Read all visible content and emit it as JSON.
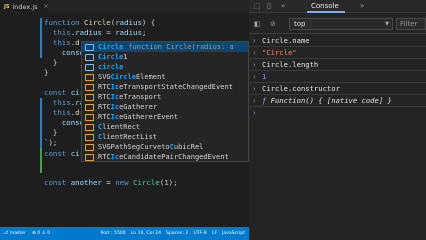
{
  "editor": {
    "tab": {
      "filename": "index.js",
      "badge": "JS",
      "close": "×"
    },
    "lines": [
      [
        [
          "kw",
          "function "
        ],
        [
          "fn",
          "Circle"
        ],
        [
          "pn",
          "("
        ],
        [
          "var",
          "radius"
        ],
        [
          "pn",
          ") {"
        ]
      ],
      [
        [
          "pn",
          "  "
        ],
        [
          "kw",
          "this"
        ],
        [
          "pn",
          "."
        ],
        [
          "var",
          "radius"
        ],
        [
          "pn",
          " = "
        ],
        [
          "var",
          "radius"
        ],
        [
          "pn",
          ";"
        ]
      ],
      [
        [
          "pn",
          "  "
        ],
        [
          "kw",
          "this"
        ],
        [
          "pn",
          "."
        ],
        [
          "fn",
          "d"
        ]
      ],
      [
        [
          "pn",
          "    "
        ],
        [
          "var",
          "conso"
        ]
      ],
      [
        [
          "pn",
          "  }"
        ]
      ],
      [
        [
          "pn",
          "}"
        ]
      ],
      [
        [
          "pn",
          ""
        ]
      ],
      [
        [
          "kw",
          "const "
        ],
        [
          "var",
          "circle"
        ],
        [
          "pn",
          " = {"
        ]
      ],
      [
        [
          "pn",
          "  "
        ],
        [
          "kw",
          "this"
        ],
        [
          "pn",
          "."
        ],
        [
          "var",
          "radi"
        ]
      ],
      [
        [
          "pn",
          "  "
        ],
        [
          "kw",
          "this"
        ],
        [
          "pn",
          "."
        ],
        [
          "fn",
          "draw"
        ]
      ],
      [
        [
          "pn",
          "    "
        ],
        [
          "var",
          "console"
        ]
      ],
      [
        [
          "pn",
          "  }"
        ]
      ],
      [
        [
          "pn",
          "`);"
        ]
      ],
      [
        [
          "kw",
          "const "
        ],
        [
          "var",
          "circle"
        ],
        [
          "pn",
          " = "
        ],
        [
          "kw",
          "new "
        ],
        [
          "cls",
          "Circ"
        ]
      ],
      [
        [
          "pn",
          ""
        ]
      ],
      [
        [
          "kw",
          "const "
        ],
        [
          "var",
          "another"
        ],
        [
          "pn",
          " = "
        ],
        [
          "kw",
          "new "
        ],
        [
          "cls",
          "Circle"
        ],
        [
          "pn",
          "("
        ],
        [
          "num",
          "1"
        ],
        [
          "pn",
          ");"
        ]
      ]
    ],
    "suggestions": [
      {
        "match": "Circle",
        "rest": "",
        "detail": "function Circle(radius: a",
        "kind": "var"
      },
      {
        "match": "Circle",
        "rest": "1",
        "detail": "",
        "kind": "var"
      },
      {
        "match": "circle",
        "rest": "",
        "detail": "",
        "kind": "var"
      },
      {
        "pre": "SVG",
        "match": "Circle",
        "rest": "Element",
        "detail": "",
        "kind": "cls"
      },
      {
        "pre": "RTC",
        "match": "Ic",
        "rest": "eTransportStateChangedEvent",
        "detail": "",
        "kind": "cls"
      },
      {
        "pre": "RTC",
        "match": "Ic",
        "rest": "eTransport",
        "detail": "",
        "kind": "cls"
      },
      {
        "pre": "RTC",
        "match": "Ic",
        "rest": "eGatherer",
        "detail": "",
        "kind": "cls"
      },
      {
        "pre": "RTC",
        "match": "Ic",
        "rest": "eGathererEvent",
        "detail": "",
        "kind": "cls"
      },
      {
        "pre": "",
        "match": "C",
        "rest": "lientRect",
        "detail": "",
        "kind": "cls"
      },
      {
        "pre": "",
        "match": "C",
        "rest": "lientRectList",
        "detail": "",
        "kind": "cls"
      },
      {
        "pre": "SVGPathSegCurveto",
        "match": "C",
        "rest": "ubicRel",
        "detail": "",
        "kind": "cls"
      },
      {
        "pre": "RTC",
        "match": "Ic",
        "rest": "eCandidatePairChangedEvent",
        "detail": "",
        "kind": "cls"
      }
    ],
    "status": {
      "branch": "⎇ master",
      "problems": "⊗ 0 ⚠ 0",
      "position": "Ln 16, Col 24",
      "spaces": "Spaces: 2",
      "encoding": "UTF-8",
      "eol": "LF",
      "language": "JavaScript",
      "port": "Port : 5500"
    }
  },
  "devtools": {
    "active_tab": "Console",
    "more_tabs": "»",
    "context": "top",
    "filter_placeholder": "Filter",
    "entries": [
      {
        "kind": "in",
        "text": "Circle.name"
      },
      {
        "kind": "out-str",
        "text": "\"Circle\""
      },
      {
        "kind": "in",
        "text": "Circle.length"
      },
      {
        "kind": "out-num",
        "text": "1"
      },
      {
        "kind": "in",
        "text": "Circle.constructor"
      },
      {
        "kind": "out-fn",
        "keyword": "ƒ",
        "text": "Function() { [native code] }"
      }
    ],
    "prompt": "›",
    "out_prompt": "‹"
  },
  "colors": {
    "statusbar": "#007acc",
    "suggest_selected": "#094771",
    "console_tab_underline": "#7cacf8"
  }
}
